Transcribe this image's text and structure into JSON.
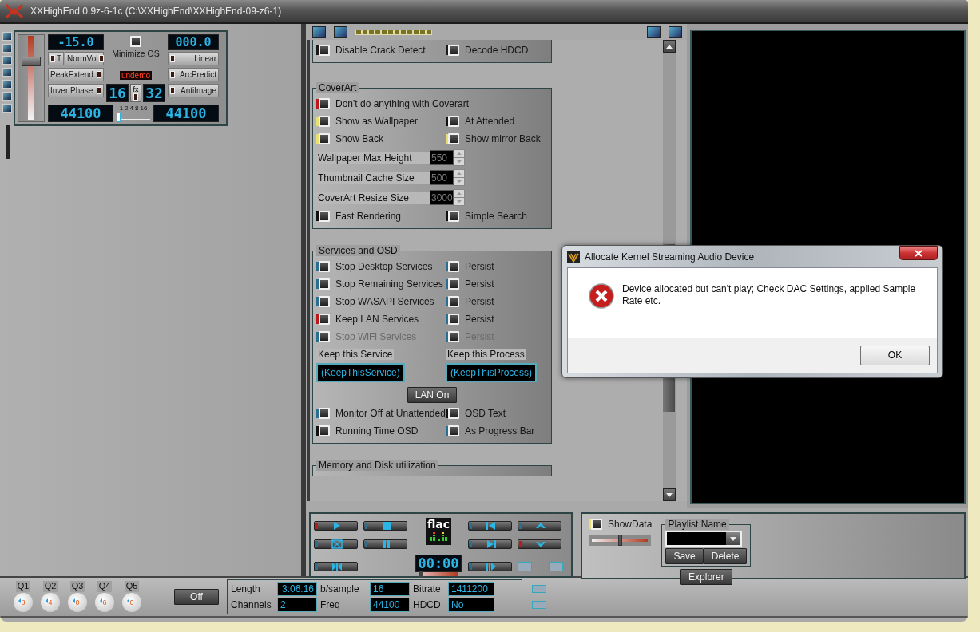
{
  "window": {
    "title": "XXHighEnd 0.9z-6-1c (C:\\XXHighEnd\\XXHighEnd-09-z6-1)"
  },
  "control_panel": {
    "volume": {
      "level": 0.72
    },
    "volume_display": "-15.0",
    "attenuation_display": "000.0",
    "minimize_os": {
      "label": "Minimize OS",
      "checked": false
    },
    "left_buttons": [
      [
        "T",
        "NormVol"
      ],
      [
        "PeakExtend"
      ],
      [
        "InvertPhase"
      ]
    ],
    "right_buttons": [
      "Linear",
      "ArcPredict",
      "AntiImage"
    ],
    "status": "undemo",
    "bits_in": "16",
    "fx": "fx",
    "bits_out": "32",
    "rate_in": "44100",
    "rate_out": "44100",
    "oversampling": {
      "ticks": [
        "1",
        "2",
        "4",
        "8",
        "16"
      ],
      "level": 0
    }
  },
  "settings": {
    "sections": [
      {
        "rows": [
          [
            {
              "kind": "check",
              "label": "Disable Crack Detect",
              "color": "#1a1a1a",
              "disabled": false,
              "checked": false
            },
            {
              "kind": "check",
              "label": "Decode HDCD",
              "color": "#1a1a1a",
              "disabled": false,
              "checked": false
            }
          ]
        ]
      },
      {
        "title": "CoverArt",
        "rows": [
          [
            {
              "kind": "check",
              "label": "Don't do anything with Coverart",
              "color": "#c01818",
              "disabled": false,
              "checked": false
            }
          ],
          [
            {
              "kind": "check",
              "label": "Show as Wallpaper",
              "color": "#e8e070",
              "disabled": false,
              "checked": false
            },
            {
              "kind": "check",
              "label": "At Attended",
              "color": "#101010",
              "disabled": false,
              "checked": false
            }
          ],
          [
            {
              "kind": "check",
              "label": "Show Back",
              "color": "#e8e070",
              "disabled": false,
              "checked": false
            },
            {
              "kind": "check",
              "label": "Show mirror Back",
              "color": "#e8e070",
              "disabled": false,
              "checked": false
            }
          ],
          [
            {
              "kind": "spinner",
              "label": "Wallpaper Max Height",
              "value": "550"
            }
          ],
          [
            {
              "kind": "spinner",
              "label": "Thumbnail Cache Size",
              "value": "500"
            }
          ],
          [
            {
              "kind": "spinner",
              "label": "CoverArt Resize Size",
              "value": "3000"
            }
          ],
          [
            {
              "kind": "check",
              "label": "Fast Rendering",
              "color": "#101010",
              "disabled": false,
              "checked": false
            },
            {
              "kind": "check",
              "label": "Simple Search",
              "color": "#101010",
              "disabled": false,
              "checked": false
            }
          ]
        ]
      },
      {
        "title": "Services and OSD",
        "rows": [
          [
            {
              "kind": "check",
              "label": "Stop Desktop Services",
              "color": "#2a6f90",
              "disabled": false,
              "checked": false
            },
            {
              "kind": "check",
              "label": "Persist",
              "color": "#2a6f90",
              "disabled": false,
              "checked": false
            }
          ],
          [
            {
              "kind": "check",
              "label": "Stop Remaining Services",
              "color": "#2a6f90",
              "disabled": false,
              "checked": false
            },
            {
              "kind": "check",
              "label": "Persist",
              "color": "#2a6f90",
              "disabled": false,
              "checked": false
            }
          ],
          [
            {
              "kind": "check",
              "label": "Stop WASAPI Services",
              "color": "#2a6f90",
              "disabled": false,
              "checked": false
            },
            {
              "kind": "check",
              "label": "Persist",
              "color": "#2a6f90",
              "disabled": false,
              "checked": false
            }
          ],
          [
            {
              "kind": "check",
              "label": "Keep LAN Services",
              "color": "#c01818",
              "disabled": false,
              "checked": false
            },
            {
              "kind": "check",
              "label": "Persist",
              "color": "#2a6f90",
              "disabled": false,
              "checked": false
            }
          ],
          [
            {
              "kind": "check",
              "label": "Stop WiFi Services",
              "color": "#2a6f90",
              "disabled": true,
              "checked": false
            },
            {
              "kind": "check",
              "label": "Persist",
              "color": "#2a6f90",
              "disabled": true,
              "checked": false
            }
          ],
          [
            {
              "kind": "field",
              "label": "Keep this Service",
              "value": "(KeepThisService)"
            },
            {
              "kind": "field",
              "label": "Keep this Process",
              "value": "(KeepThisProcess)"
            }
          ],
          [
            {
              "kind": "button",
              "label": "LAN On"
            }
          ],
          [
            {
              "kind": "check",
              "label": "Monitor Off at Unattended",
              "color": "#2a6f90",
              "disabled": false,
              "checked": false
            },
            {
              "kind": "check",
              "label": "OSD Text",
              "color": "#101010",
              "disabled": false,
              "checked": false
            }
          ],
          [
            {
              "kind": "check",
              "label": "Running Time OSD",
              "color": "#101010",
              "disabled": false,
              "checked": false
            },
            {
              "kind": "check",
              "label": "As Progress Bar",
              "color": "#2a6f90",
              "disabled": false,
              "checked": false
            }
          ]
        ]
      },
      {
        "title": "Memory and Disk utilization"
      }
    ]
  },
  "transport": {
    "buttons": [
      {
        "kind": "play",
        "color": "#c01818"
      },
      {
        "kind": "stop",
        "color": "#2a6f90"
      },
      {
        "kind": "prev",
        "color": "#2a6f90"
      },
      {
        "kind": "up",
        "color": "#2a6f90"
      },
      {
        "kind": "crossbox",
        "color": "#2a6f90"
      },
      {
        "kind": "pause",
        "color": "#2a6f90"
      },
      {
        "kind": "next",
        "color": "#2a6f90"
      },
      {
        "kind": "down",
        "color": "#c01818"
      },
      {
        "kind": "bowtie",
        "color": "#2a6f90"
      },
      {
        "kind": "playpause",
        "color": "#2a6f90"
      }
    ],
    "logo": "flac",
    "time": "00:00",
    "position": {
      "level": 0
    }
  },
  "playlist": {
    "show_data": {
      "label": "ShowData",
      "color": "#e8e070",
      "checked": false
    },
    "slider": {
      "level": 0.5
    },
    "legend": "Playlist Name",
    "buttons": [
      "Save",
      "Delete"
    ],
    "explorer": "Explorer"
  },
  "bottom": {
    "presets": [
      {
        "label": "Q1",
        "value": "8"
      },
      {
        "label": "Q2",
        "value": "4"
      },
      {
        "label": "Q3",
        "value": "0"
      },
      {
        "label": "Q4",
        "value": "6"
      },
      {
        "label": "Q5",
        "value": "0"
      }
    ],
    "off_button": "Off",
    "info": [
      {
        "label": "Length",
        "value": "3:06.16"
      },
      {
        "label": "b/sample",
        "value": "16"
      },
      {
        "label": "Bitrate",
        "value": "1411200"
      },
      {
        "label": "Channels",
        "value": "2"
      },
      {
        "label": "Freq",
        "value": "44100"
      },
      {
        "label": "HDCD",
        "value": "No"
      }
    ]
  },
  "dialog": {
    "title": "Allocate Kernel Streaming Audio Device",
    "message": "Device allocated but can't play; Check DAC Settings, applied Sample Rate etc.",
    "button": "OK"
  }
}
